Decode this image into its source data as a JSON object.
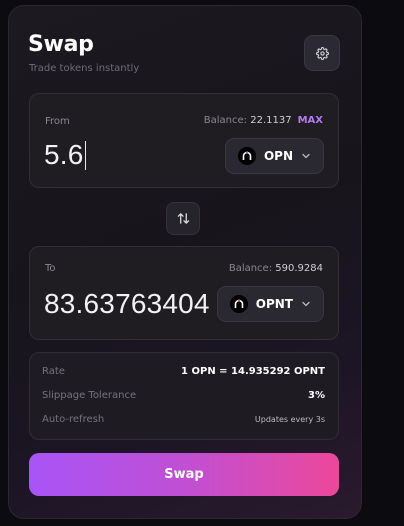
{
  "header": {
    "title": "Swap",
    "subtitle": "Trade tokens instantly"
  },
  "from": {
    "label": "From",
    "balance_label": "Balance:",
    "balance_value": "22.1137",
    "max_label": "MAX",
    "amount": "5.6",
    "token": "OPN"
  },
  "to": {
    "label": "To",
    "balance_label": "Balance:",
    "balance_value": "590.9284",
    "amount": "83.63763404",
    "token": "OPNT"
  },
  "info": {
    "rate_label": "Rate",
    "rate_value": "1 OPN = 14.935292 OPNT",
    "slippage_label": "Slippage Tolerance",
    "slippage_value": "3%",
    "refresh_label": "Auto-refresh",
    "refresh_value": "Updates every 3s"
  },
  "actions": {
    "swap_label": "Swap"
  },
  "icons": {
    "settings": "gear-icon",
    "direction": "swap-arrows-icon",
    "dropdown": "chevron-down-icon",
    "token": "token-logo-icon"
  },
  "colors": {
    "accent_start": "#a855f7",
    "accent_end": "#ec4899",
    "max": "#b07cf2"
  }
}
